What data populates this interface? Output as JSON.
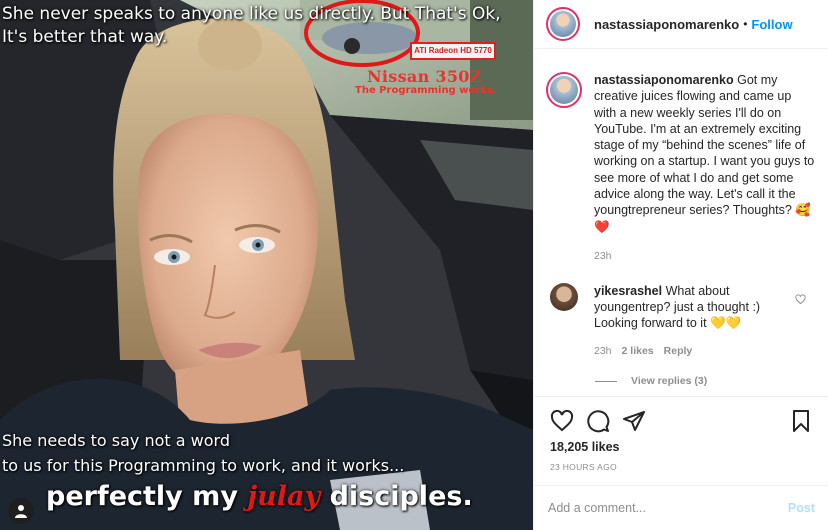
{
  "photo": {
    "overlay_top_line1": "She never speaks to anyone like us directly. But That's Ok,",
    "overlay_top_line2": "It's better that way.",
    "overlay_bottom_line1": "She needs to say not a word",
    "overlay_bottom_line2": "to us for this Programming to work, and it works...",
    "overlay_big_pre": "perfectly my ",
    "overlay_big_accent": "julay",
    "overlay_big_post": " disciples.",
    "gpu_label": "ATI Radeon HD 5770",
    "car_model": "Nissan 350Z",
    "car_sub": "The Programming works."
  },
  "header": {
    "username": "nastassiaponomarenko",
    "separator": "•",
    "follow_label": "Follow"
  },
  "caption": {
    "username": "nastassiaponomarenko",
    "text": " Got my creative juices flowing and came up with a new weekly series I'll do on YouTube. I'm at an extremely exciting stage of my “behind the scenes” life of working on a startup. I want you guys to see more of what I do and get some advice along the way. Let's call it the youngtrepreneur series? Thoughts? 🥰❤️",
    "time": "23h"
  },
  "comment": {
    "username": "yikesrashel",
    "text": " What about youngentrep? just a thought :) Looking forward to it 💛💛",
    "time": "23h",
    "likes": "2 likes",
    "reply_label": "Reply",
    "view_replies": "View replies (3)"
  },
  "actions": {
    "likes": "18,205 likes",
    "ago": "23 HOURS AGO"
  },
  "add_comment": {
    "placeholder": "Add a comment...",
    "post_label": "Post"
  },
  "colors": {
    "accent_blue": "#0095f6",
    "annotation_red": "#e01818"
  },
  "icons": [
    "heart-icon",
    "comment-icon",
    "share-icon",
    "bookmark-icon",
    "user-tag-icon"
  ]
}
